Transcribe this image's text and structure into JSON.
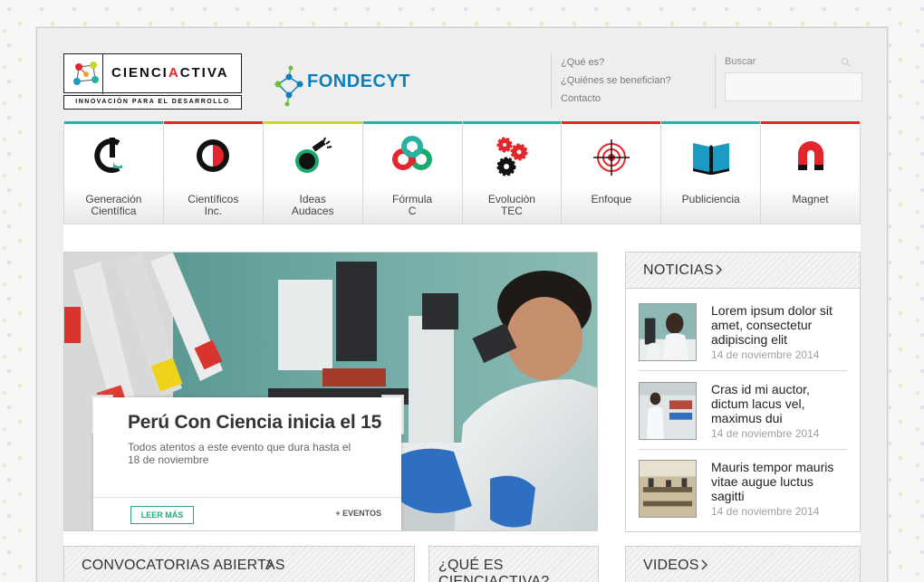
{
  "header": {
    "logo_name_part1": "CIENCI",
    "logo_name_accent": "A",
    "logo_name_part2": "CTIVA",
    "logo_tagline": "INNOVACIÓN PARA EL DESARROLLO",
    "partner_logo": "FONDECYT",
    "links": [
      "¿Qué es?",
      "¿Quiénes se benefician?",
      "Contacto"
    ],
    "search_label": "Buscar",
    "search_placeholder": ""
  },
  "nav": {
    "items": [
      {
        "label": "Generación\nCientífica",
        "icon": "gc-icon",
        "color": "#2ab0a0"
      },
      {
        "label": "Científicos\nInc.",
        "icon": "half-circle-icon",
        "color": "#e3262c"
      },
      {
        "label": "Ideas\nAudaces",
        "icon": "flask-icon",
        "color": "#1ba86c"
      },
      {
        "label": "Fórmula\nC",
        "icon": "rings-icon",
        "color": "#e3262c"
      },
      {
        "label": "Evoluciòn\nTEC",
        "icon": "gears-icon",
        "color": "#e3262c"
      },
      {
        "label": "Enfoque",
        "icon": "target-icon",
        "color": "#e3262c"
      },
      {
        "label": "Publiciencia",
        "icon": "book-icon",
        "color": "#1a9bc4"
      },
      {
        "label": "Magnet",
        "icon": "magnet-icon",
        "color": "#e3262c"
      }
    ],
    "top_colors": [
      "#2ab0a0",
      "#e3262c",
      "#c9d62a",
      "#2ab0a0",
      "#2ab0a0",
      "#e3262c",
      "#2ab0a0",
      "#e3262c"
    ]
  },
  "hero": {
    "title": "Perú Con Ciencia inicia el 15",
    "text": "Todos atentos a este evento que dura hasta el 18 de noviembre",
    "read_more": "LEER MÁS",
    "events": "+ EVENTOS",
    "prev": "«",
    "next": "»"
  },
  "news": {
    "title": "NOTICIAS",
    "items": [
      {
        "title": "Lorem ipsum dolor sit amet, consectetur adipiscing elit",
        "date": "14 de noviembre 2014"
      },
      {
        "title": "Cras id mi auctor, dictum lacus vel, maximus dui",
        "date": "14 de noviembre 2014"
      },
      {
        "title": "Mauris tempor mauris vitae augue luctus sagitti",
        "date": "14 de noviembre 2014"
      }
    ]
  },
  "bottom": {
    "convocatorias": "CONVOCATORIAS ABIERTAS",
    "que_es": "¿QUÉ ES CIENCIACTIVA?",
    "videos": "VIDEOS"
  }
}
